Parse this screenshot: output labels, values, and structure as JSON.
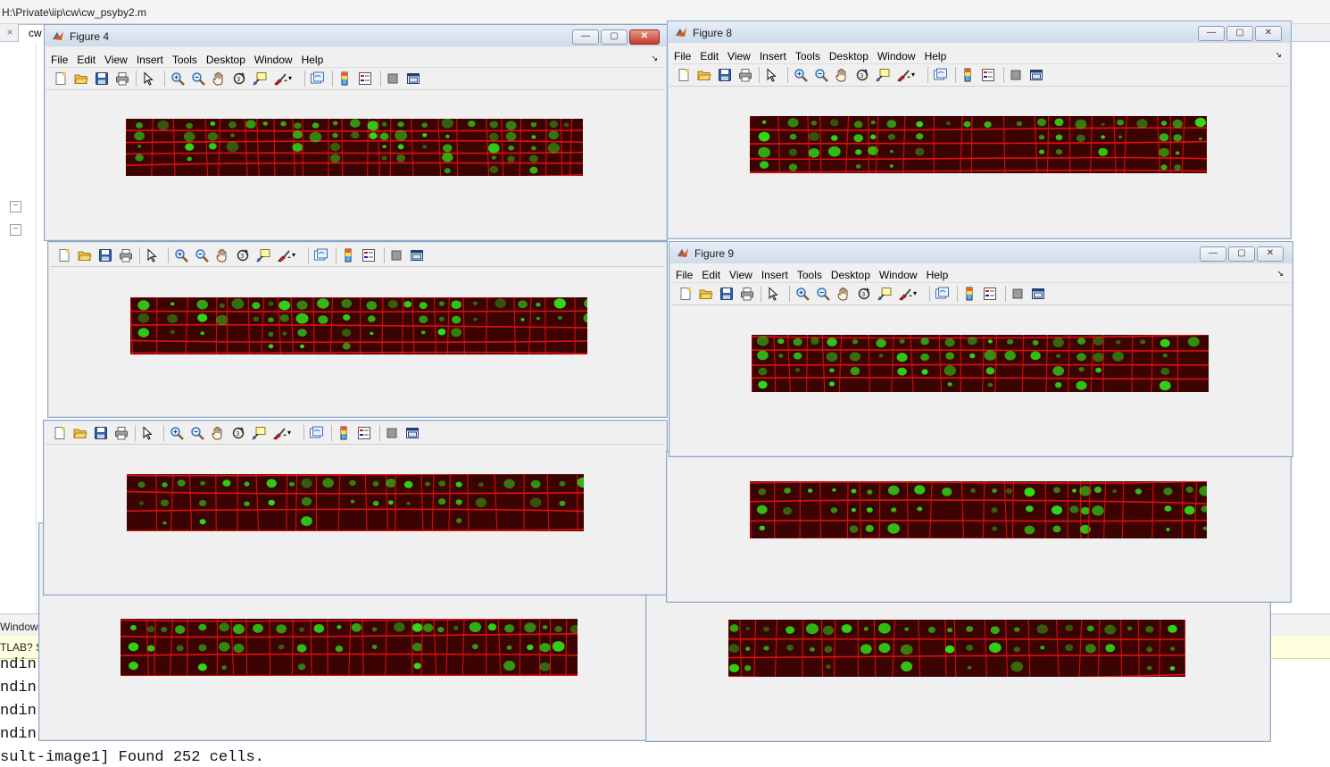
{
  "editor": {
    "path": "H:\\Private\\iip\\cw\\cw_psyby2.m",
    "tab_label": "cw",
    "tab_close_glyph": "×"
  },
  "command_window": {
    "label": "Window",
    "notice": "TLAB? S",
    "lines": [
      "ndin",
      "ndin",
      "ndin",
      "ndin",
      "sult-image1] Found 252 cells."
    ]
  },
  "figure_menu": [
    "File",
    "Edit",
    "View",
    "Insert",
    "Tools",
    "Desktop",
    "Window",
    "Help"
  ],
  "figures": {
    "fig4": {
      "title": "Figure 4"
    },
    "fig8": {
      "title": "Figure 8"
    },
    "fig9": {
      "title": "Figure 9"
    }
  },
  "toolbar_icons": [
    "new-figure-icon",
    "open-file-icon",
    "save-icon",
    "print-icon",
    "select-arrow-icon",
    "zoom-in-icon",
    "zoom-out-icon",
    "pan-hand-icon",
    "rotate-3d-icon",
    "data-cursor-icon",
    "brush-icon",
    "link-plot-icon",
    "colorbar-icon",
    "legend-icon",
    "hide-plot-tools-icon",
    "show-plot-tools-icon"
  ],
  "window_buttons": {
    "minimize": "—",
    "maximize": "▢",
    "close": "✕"
  },
  "colors": {
    "membrane": "#e01010",
    "nucleus": "#2ee81a",
    "background": "#1a0000",
    "titlebar": "#d6e2f0"
  }
}
